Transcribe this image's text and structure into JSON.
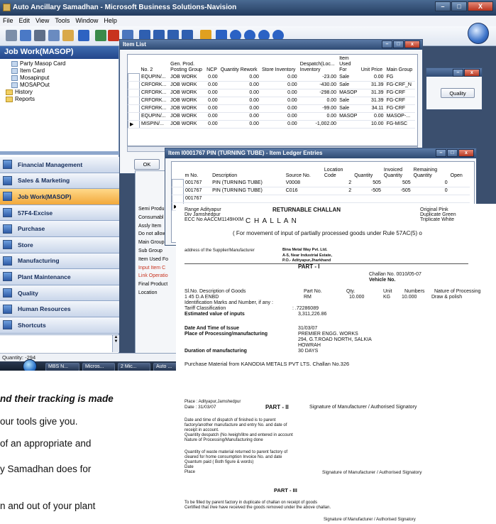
{
  "window": {
    "title": "Auto Ancillary Samadhan - Microsoft Business Solutions-Navision",
    "buttons": {
      "minimize": "–",
      "maximize": "□",
      "close": "X"
    }
  },
  "menu": [
    "File",
    "Edit",
    "View",
    "Tools",
    "Window",
    "Help"
  ],
  "toolbar": {
    "icons": [
      "print-icon",
      "preview-icon",
      "cut-icon",
      "copy-icon",
      "paste-icon",
      "undo-icon",
      "find-icon",
      "delete-icon",
      "find-record-icon",
      "list-icon",
      "card-icon",
      "table-icon",
      "sort-icon",
      "filter-icon",
      "first-record-icon",
      "previous-record-icon",
      "next-record-icon",
      "last-record-icon",
      "help-icon"
    ],
    "colors": {
      "primary": "#2b62c4",
      "accent": "#e0a020",
      "danger": "#c8321e"
    }
  },
  "nav": {
    "header": "Job Work(MASOP)",
    "tree": [
      {
        "label": "Party Masop Card",
        "type": "item"
      },
      {
        "label": "Item Card",
        "type": "item"
      },
      {
        "label": "Mosapinput",
        "type": "item"
      },
      {
        "label": "MOSAPOut",
        "type": "item"
      },
      {
        "label": "History",
        "type": "folder"
      },
      {
        "label": "Reports",
        "type": "folder"
      }
    ],
    "modules": [
      {
        "label": "Financial Management",
        "active": false
      },
      {
        "label": "Sales & Marketing",
        "active": false
      },
      {
        "label": "Job Work(MASOP)",
        "active": true
      },
      {
        "label": "57F4-Excise",
        "active": false
      },
      {
        "label": "Purchase",
        "active": false
      },
      {
        "label": "Store",
        "active": false
      },
      {
        "label": "Manufacturing",
        "active": false
      },
      {
        "label": "Plant Maintenance",
        "active": false
      },
      {
        "label": "Quality",
        "active": false
      },
      {
        "label": "Human Resources",
        "active": false
      },
      {
        "label": "Shortcuts",
        "active": false
      }
    ]
  },
  "status": {
    "quantity": "Quantity: -294"
  },
  "taskbar": {
    "items": [
      "MBS N...",
      "Micros...",
      "2 Mic...",
      "Auto ..."
    ]
  },
  "item_list": {
    "title": "Item List",
    "columns": [
      "No. 2",
      "Gen. Prod.\nPosting Group",
      "NCP",
      "Quantity Rework",
      "Store Inventory",
      "Despatch(Loc...\nInventory",
      "Item\nUsed\nFor",
      "Unit Price",
      "Main Group"
    ],
    "rows": [
      [
        "EQUPIN/...",
        "JOB WORK",
        "0.00",
        "0.00",
        "0.00",
        "-23.00",
        "Sale",
        "0.00",
        "FG"
      ],
      [
        "CRFORK...",
        "JOB WORK",
        "0.00",
        "0.00",
        "0.00",
        "-430.00",
        "Sale",
        "31.39",
        "FG-CRF_N"
      ],
      [
        "CRFORK...",
        "JOB WORK",
        "0.00",
        "0.00",
        "0.00",
        "-298.00",
        "MASOP",
        "31.39",
        "FG-CRF"
      ],
      [
        "CRFORK...",
        "JOB WORK",
        "0.00",
        "0.00",
        "0.00",
        "0.00",
        "Sale",
        "31.39",
        "FG-CRF"
      ],
      [
        "CRFORK...",
        "JOB WORK",
        "0.00",
        "0.00",
        "0.00",
        "-99.00",
        "Sale",
        "34.11",
        "FG-CRF"
      ],
      [
        "EQUPIN/...",
        "JOB WORK",
        "0.00",
        "0.00",
        "0.00",
        "0.00",
        "MASOP",
        "0.00",
        "MASOP-..."
      ],
      [
        "MISPIN/...",
        "JOB WORK",
        "0.00",
        "0.00",
        "0.00",
        "-1,002.00",
        "",
        "10.00",
        "FG-MISC"
      ]
    ],
    "ok_label": "OK",
    "quality_label": "Quality"
  },
  "item_card": {
    "fields": [
      "Semi Produ",
      "Consumabl",
      "Assly Item",
      "Do not allow",
      "Main Group",
      "Sub Group",
      "Item Used Fo",
      "Input Item C",
      "Link Operatio",
      "Final Product",
      "Location"
    ],
    "red_fields": [
      7,
      8
    ]
  },
  "ledger": {
    "title": "Item I0001767 PIN (TURNING TUBE) - Item Ledger Entries",
    "columns": [
      "m No.",
      "Description",
      "Source No.",
      "Location\nCode",
      "Quantity",
      "Invoiced\nQuantity",
      "Remaining\nQuantity",
      "Open"
    ],
    "rows": [
      [
        "001767",
        "PIN (TURNING TUBE)",
        "V0008",
        "2",
        "505",
        "505",
        "0",
        ""
      ],
      [
        "001767",
        "PIN (TURNING TUBE)",
        "C016",
        "2",
        "-505",
        "-505",
        "0",
        ""
      ],
      [
        "001767",
        "",
        "",
        "",
        "",
        "",
        "",
        ""
      ],
      [
        "001767",
        "",
        "",
        "",
        "",
        "",
        "",
        ""
      ]
    ]
  },
  "challan": {
    "range": "Range  Adityapur",
    "div": "Div  Jamshedpur",
    "ecc": "ECC No  AACCM1149HXM",
    "heading": "RETURNABLE CHALLAN",
    "copies": [
      "Original   Pink",
      "Duplicate  Green",
      "Triplicate  White"
    ],
    "title": "C H A L L A N",
    "subtitle": "( For movement of input of partially processed goods under Rule 57AC(5) o",
    "supplier_label": "address of the Supplier/Manufacturer",
    "supplier_name": "Bina Metal Way Pvt. Ltd.",
    "supplier_addr1": "A-5, Near Industrial Estate,",
    "supplier_addr2": "P.O.- Adityapur,Jharkhand",
    "part1": "PART - I",
    "challan_no": "Challan No.   0010/05-07",
    "vehicle_no": "Vehicle No.",
    "table_header": [
      "Sl.No. Description of Goods",
      "Part No.",
      "Qty.",
      "Unit",
      "Numbers",
      "Nature of Processing"
    ],
    "table_row": [
      "1    45 D.A ENBD",
      "RM",
      "10.000",
      "KG",
      "10.000",
      "Draw & polish"
    ],
    "ident_label": "Identification Marks and Number, if any :",
    "tariff_label": "Tariff Classification",
    "tariff_value": ":   .72286089",
    "estimated_label": "Estimated value of inputs",
    "estimated_value": "3,311,226.86",
    "date_label": "Date And Time of Issue",
    "date_value": "31/03/07",
    "place_label": "Place of Processing/manufacturing",
    "place_value1": "PREMIER ENGG. WORKS",
    "place_value2": "294, G.T.ROAD NORTH, SALKIA",
    "place_value3": "HOWRAH",
    "duration_label": "Duration of manufacturing",
    "duration_value": "30 DAYS",
    "purchase_line": "Purchase Material from KANODIA METALS PVT LTS. Challan No.326",
    "place_sign": "Place : Adityapur,Jamshedpur",
    "date_sign": "Date :           31/03/07",
    "part2": "PART - II",
    "signature_line": "Signature of Manufacturer / Authorised Signatory",
    "part2_lines": [
      "Date and time of dispatch of finished is to parent",
      "factory/another manufacture and entry No. and date of",
      "receipt in account.",
      "Quantity despatch (No /weigh/litre and entered in account",
      "Nature of Processing/Manufacturing done"
    ],
    "waste_lines": [
      "Quantity of waste material returned to parent factory of",
      "cleared for home consumption Invoice No. and date",
      "Quantum paid ( Both figure & words)",
      "  Date",
      "  Place"
    ],
    "signature2": "Signature of Manufacturer / Authorised Signatory",
    "part3": "PART - III",
    "part3_lines": [
      "To be filled by parent factory in duplicate of challan on receipt of goods",
      "Certified that I/we have received the goods removed under the above challan."
    ],
    "signature3": "Signature of Manufacturer / Authorised Signatory"
  },
  "article": {
    "lines": [
      "nd their tracking is made",
      "our tools give you.",
      "of an appropriate and",
      "y Samadhan does for",
      "n and out of your plant"
    ]
  }
}
